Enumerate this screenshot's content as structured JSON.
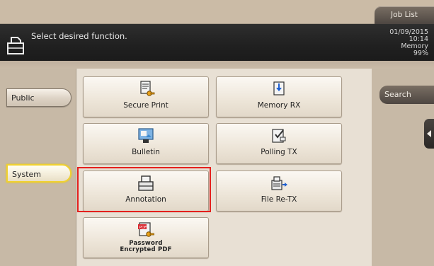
{
  "top_bar": {
    "job_list_label": "Job List"
  },
  "header": {
    "message": "Select desired function.",
    "date": "01/09/2015",
    "time": "10:14",
    "memory_label": "Memory",
    "memory_value": "99%"
  },
  "sidebar": {
    "items": [
      {
        "label": "Public"
      },
      {
        "label": "System",
        "selected": true
      }
    ]
  },
  "functions": [
    {
      "label": "Secure Print",
      "icon": "secure-print-icon"
    },
    {
      "label": "Memory RX",
      "icon": "memory-rx-icon"
    },
    {
      "label": "Bulletin",
      "icon": "bulletin-icon"
    },
    {
      "label": "Polling TX",
      "icon": "polling-tx-icon"
    },
    {
      "label": "Annotation",
      "icon": "annotation-icon",
      "highlighted": true
    },
    {
      "label": "File Re-TX",
      "icon": "file-re-tx-icon"
    },
    {
      "label_line1": "Password",
      "label_line2": "Encrypted PDF",
      "icon": "password-encrypted-pdf-icon"
    }
  ],
  "right_panel": {
    "search_label": "Search"
  },
  "colors": {
    "highlight": "#e4201d",
    "selected_border": "#f0d132",
    "header_bg": "#222222"
  }
}
